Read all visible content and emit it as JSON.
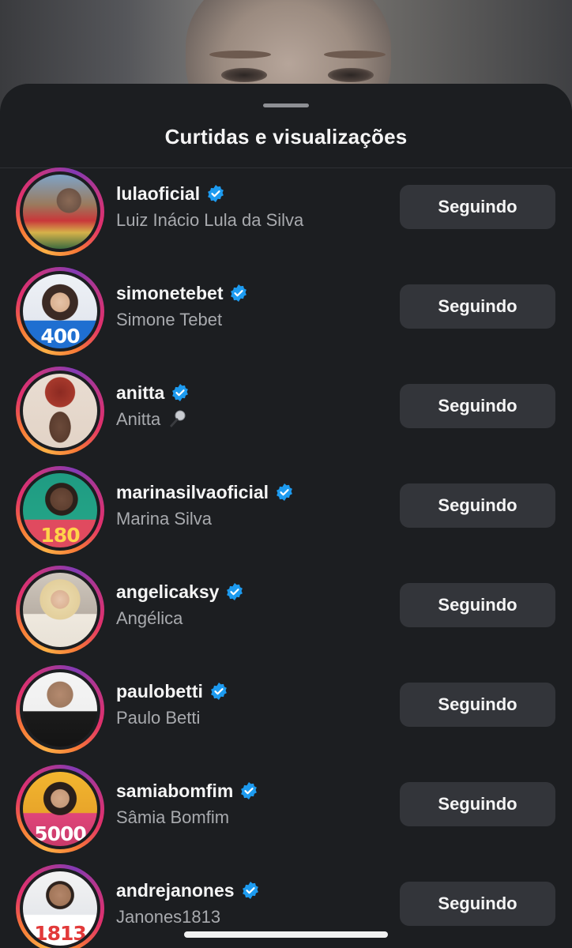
{
  "sheet": {
    "title": "Curtidas e visualizações"
  },
  "colors": {
    "sheet_bg": "#1c1e21",
    "button_bg": "#33353a",
    "verified": "#1d9bf0",
    "secondary_text": "#a8aaae"
  },
  "users": [
    {
      "username": "lulaoficial",
      "name": "Luiz Inácio Lula da Silva",
      "verified": true,
      "button": "Seguindo",
      "avatar_badge": ""
    },
    {
      "username": "simonetebet",
      "name": "Simone Tebet",
      "verified": true,
      "button": "Seguindo",
      "avatar_badge": "400"
    },
    {
      "username": "anitta",
      "name": "Anitta",
      "name_icon": "microphone-icon",
      "verified": true,
      "button": "Seguindo",
      "avatar_badge": ""
    },
    {
      "username": "marinasilvaoficial",
      "name": "Marina Silva",
      "verified": true,
      "button": "Seguindo",
      "avatar_badge": "180"
    },
    {
      "username": "angelicaksy",
      "name": "Angélica",
      "verified": true,
      "button": "Seguindo",
      "avatar_badge": ""
    },
    {
      "username": "paulobetti",
      "name": "Paulo Betti",
      "verified": true,
      "button": "Seguindo",
      "avatar_badge": ""
    },
    {
      "username": "samiabomfim",
      "name": "Sâmia Bomfim",
      "verified": true,
      "button": "Seguindo",
      "avatar_badge": "5000"
    },
    {
      "username": "andrejanones",
      "name": "Janones1813",
      "verified": true,
      "button": "Seguindo",
      "avatar_badge": "1813"
    }
  ]
}
